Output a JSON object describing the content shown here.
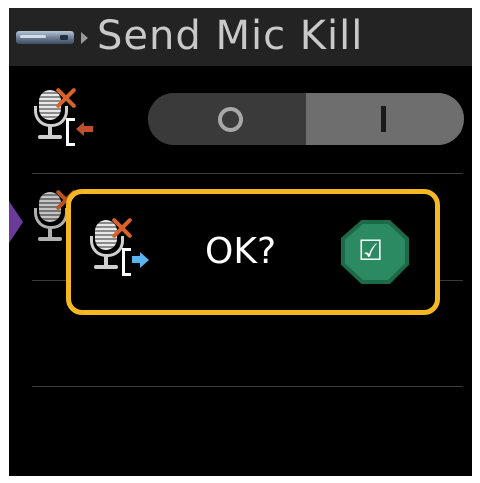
{
  "header": {
    "title": "Send Mic Kill",
    "device_icon": "device-icon",
    "nav_icon": "chevron-right-icon"
  },
  "toggle": {
    "off_label": "O",
    "on_label": "I",
    "state": "on"
  },
  "rows": [
    {
      "icon": "mic-kill-receive-icon"
    },
    {
      "icon": "mic-kill-send-icon"
    }
  ],
  "dialog": {
    "prompt": "OK?",
    "confirm_symbol": "☑",
    "icon": "mic-kill-send-icon"
  },
  "colors": {
    "accent_border": "#f5b820",
    "confirm_green": "#2c8a62",
    "header_bg": "#232323",
    "mic_x": "#d9622a",
    "send_arrow": "#5ab4ee",
    "receive_arrow": "#c0502a",
    "selection_tab": "#6b3a9a"
  }
}
